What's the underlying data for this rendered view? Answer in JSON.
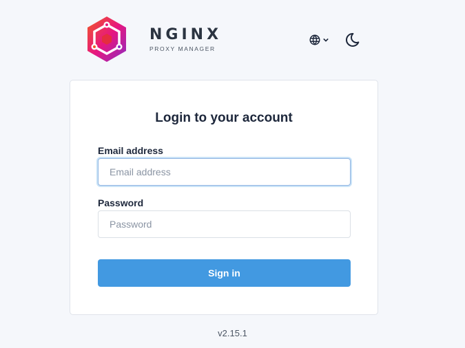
{
  "brand": {
    "name": "NGINX",
    "subtitle": "PROXY MANAGER",
    "logo_icon": "nginx-proxy-manager-hexagon-logo"
  },
  "header": {
    "language_icon": "globe-icon",
    "theme_icon": "moon-icon"
  },
  "login": {
    "title": "Login to your account",
    "email_label": "Email address",
    "email_placeholder": "Email address",
    "email_value": "",
    "password_label": "Password",
    "password_placeholder": "Password",
    "password_value": "",
    "submit_label": "Sign in"
  },
  "footer": {
    "version": "v2.15.1"
  },
  "colors": {
    "background": "#f5f7fb",
    "primary": "#4299e1",
    "text": "#1d273b"
  }
}
